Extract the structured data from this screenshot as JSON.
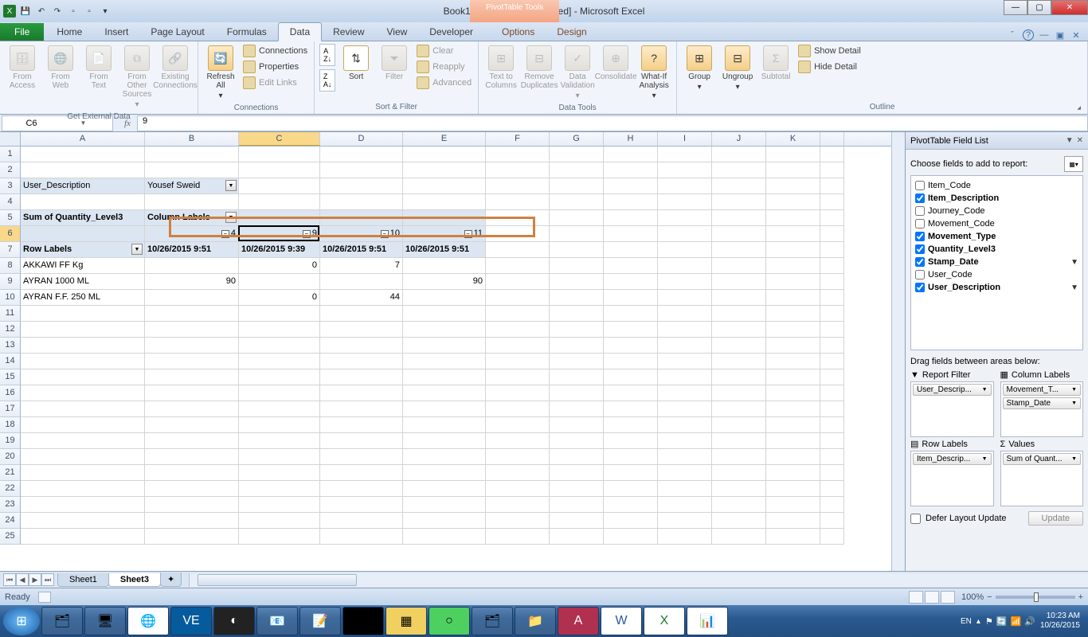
{
  "title": "Book1 (version 1) [Autosaved] - Microsoft Excel",
  "pivot_tools_label": "PivotTable Tools",
  "tabs": {
    "file": "File",
    "home": "Home",
    "insert": "Insert",
    "page": "Page Layout",
    "formulas": "Formulas",
    "data": "Data",
    "review": "Review",
    "view": "View",
    "developer": "Developer",
    "options": "Options",
    "design": "Design"
  },
  "ribbon": {
    "get_external": {
      "label": "Get External Data",
      "access": "From\nAccess",
      "web": "From\nWeb",
      "text": "From\nText",
      "other": "From Other\nSources",
      "existing": "Existing\nConnections"
    },
    "connections": {
      "label": "Connections",
      "refresh": "Refresh\nAll",
      "conn": "Connections",
      "prop": "Properties",
      "edit": "Edit Links"
    },
    "sortfilter": {
      "label": "Sort & Filter",
      "sort": "Sort",
      "filter": "Filter",
      "clear": "Clear",
      "reapply": "Reapply",
      "advanced": "Advanced"
    },
    "datatools": {
      "label": "Data Tools",
      "ttc": "Text to\nColumns",
      "remdup": "Remove\nDuplicates",
      "valid": "Data\nValidation",
      "consol": "Consolidate",
      "whatif": "What-If\nAnalysis"
    },
    "outline": {
      "label": "Outline",
      "group": "Group",
      "ungroup": "Ungroup",
      "subtotal": "Subtotal",
      "showdet": "Show Detail",
      "hidedet": "Hide Detail"
    }
  },
  "name_box": "C6",
  "formula": "9",
  "cols": [
    "A",
    "B",
    "C",
    "D",
    "E",
    "F",
    "G",
    "H",
    "I",
    "J",
    "K"
  ],
  "grid": {
    "r3": {
      "A": "User_Description",
      "B": "Yousef Sweid"
    },
    "r5": {
      "A": "Sum of Quantity_Level3",
      "B": "Column Labels"
    },
    "r6": {
      "B": "4",
      "C": "9",
      "D": "10",
      "E": "11"
    },
    "r7": {
      "A": "Row Labels",
      "B": "10/26/2015 9:51",
      "C": "10/26/2015 9:39",
      "D": "10/26/2015 9:51",
      "E": "10/26/2015 9:51"
    },
    "r8": {
      "A": "AKKAWI FF Kg",
      "C": "0",
      "D": "7"
    },
    "r9": {
      "A": "AYRAN 1000 ML",
      "B": "90",
      "E": "90"
    },
    "r10": {
      "A": "AYRAN F.F. 250 ML",
      "C": "0",
      "D": "44"
    }
  },
  "pivot": {
    "header": "PivotTable Field List",
    "choose": "Choose fields to add to report:",
    "fields": [
      {
        "name": "Item_Code",
        "checked": false
      },
      {
        "name": "Item_Description",
        "checked": true
      },
      {
        "name": "Journey_Code",
        "checked": false
      },
      {
        "name": "Movement_Code",
        "checked": false
      },
      {
        "name": "Movement_Type",
        "checked": true
      },
      {
        "name": "Quantity_Level3",
        "checked": true
      },
      {
        "name": "Stamp_Date",
        "checked": true,
        "filter": true
      },
      {
        "name": "User_Code",
        "checked": false
      },
      {
        "name": "User_Description",
        "checked": true,
        "filter": true
      }
    ],
    "drag_hint": "Drag fields between areas below:",
    "areas": {
      "report_filter": "Report Filter",
      "col_labels": "Column Labels",
      "row_labels": "Row Labels",
      "values": "Values",
      "filter_items": [
        "User_Descrip..."
      ],
      "col_items": [
        "Movement_T...",
        "Stamp_Date"
      ],
      "row_items": [
        "Item_Descrip..."
      ],
      "val_items": [
        "Sum of Quant..."
      ]
    },
    "defer": "Defer Layout Update",
    "update": "Update"
  },
  "sheets": {
    "s1": "Sheet1",
    "s2": "Sheet3"
  },
  "status": {
    "ready": "Ready",
    "zoom": "100%"
  },
  "tray": {
    "lang": "EN",
    "time": "10:23 AM",
    "date": "10/26/2015"
  }
}
